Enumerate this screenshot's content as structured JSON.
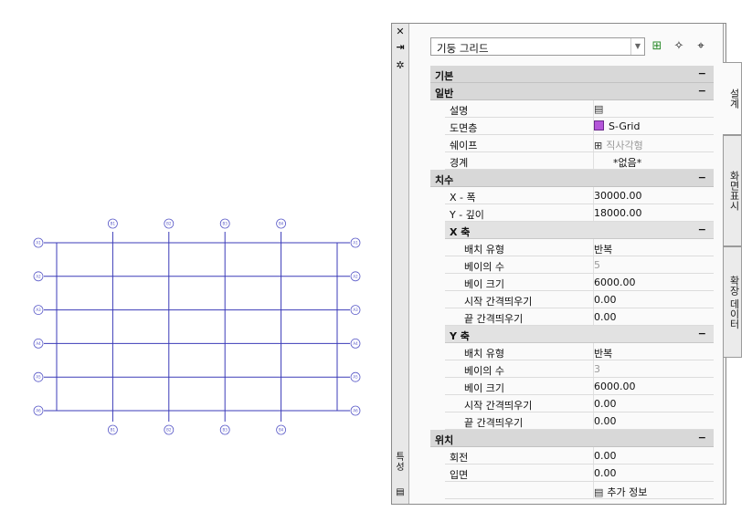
{
  "drawing": {
    "top_bubbles": [
      "B1",
      "B2",
      "B3",
      "B4"
    ],
    "bottom_bubbles": [
      "B1",
      "B2",
      "B3",
      "B4"
    ],
    "left_bubbles": [
      "A1",
      "A2",
      "A3",
      "A4",
      "A5",
      "A6"
    ],
    "right_bubbles": [
      "A1",
      "A2",
      "A3",
      "A4",
      "A5",
      "A6"
    ],
    "line_color": "#3b3bb8"
  },
  "palette": {
    "title_chars": [
      "특",
      "성"
    ],
    "toolbar_icons": [
      "close-icon",
      "auto-hide-icon",
      "properties-icon"
    ],
    "style_select": {
      "value": "기둥 그리드"
    },
    "tools": [
      "add-selection-icon",
      "quick-select-icon",
      "select-objects-icon"
    ],
    "tabs": [
      {
        "label": "설계",
        "active": true
      },
      {
        "label": "화면표시",
        "active": false
      },
      {
        "label": "확장 데이터",
        "active": false
      }
    ],
    "rows": [
      {
        "kind": "cat",
        "label": "기본",
        "toggle": "−"
      },
      {
        "kind": "cat",
        "label": "일반",
        "toggle": "−"
      },
      {
        "kind": "prop",
        "label": "설명",
        "icon": "table-icon",
        "value": ""
      },
      {
        "kind": "prop",
        "label": "도면층",
        "swatch": "#b455d9",
        "value": "S-Grid"
      },
      {
        "kind": "prop",
        "label": "쉐이프",
        "icon": "grid-shape-icon",
        "value": "직사각형",
        "dim": true
      },
      {
        "kind": "prop",
        "label": "경계",
        "value": "*없음*",
        "center": true
      },
      {
        "kind": "cat",
        "label": "치수",
        "toggle": "−"
      },
      {
        "kind": "prop",
        "label": "X - 폭",
        "value": "30000.00"
      },
      {
        "kind": "prop",
        "label": "Y - 깊이",
        "value": "18000.00"
      },
      {
        "kind": "sub",
        "label": "X 축",
        "toggle": "−"
      },
      {
        "kind": "prop2",
        "label": "배치 유형",
        "value": "반복"
      },
      {
        "kind": "prop2",
        "label": "베이의 수",
        "value": "5",
        "dim": true
      },
      {
        "kind": "prop2",
        "label": "베이 크기",
        "value": "6000.00"
      },
      {
        "kind": "prop2",
        "label": "시작 간격띄우기",
        "value": "0.00"
      },
      {
        "kind": "prop2",
        "label": "끝 간격띄우기",
        "value": "0.00"
      },
      {
        "kind": "sub",
        "label": "Y 축",
        "toggle": "−"
      },
      {
        "kind": "prop2",
        "label": "배치 유형",
        "value": "반복"
      },
      {
        "kind": "prop2",
        "label": "베이의 수",
        "value": "3",
        "dim": true
      },
      {
        "kind": "prop2",
        "label": "베이 크기",
        "value": "6000.00"
      },
      {
        "kind": "prop2",
        "label": "시작 간격띄우기",
        "value": "0.00"
      },
      {
        "kind": "prop2",
        "label": "끝 간격띄우기",
        "value": "0.00"
      },
      {
        "kind": "cat",
        "label": "위치",
        "toggle": "−"
      },
      {
        "kind": "prop",
        "label": "회전",
        "value": "0.00"
      },
      {
        "kind": "prop",
        "label": "입면",
        "value": "0.00"
      },
      {
        "kind": "prop",
        "label": "",
        "icon": "table-icon",
        "value": "추가 정보"
      }
    ]
  }
}
